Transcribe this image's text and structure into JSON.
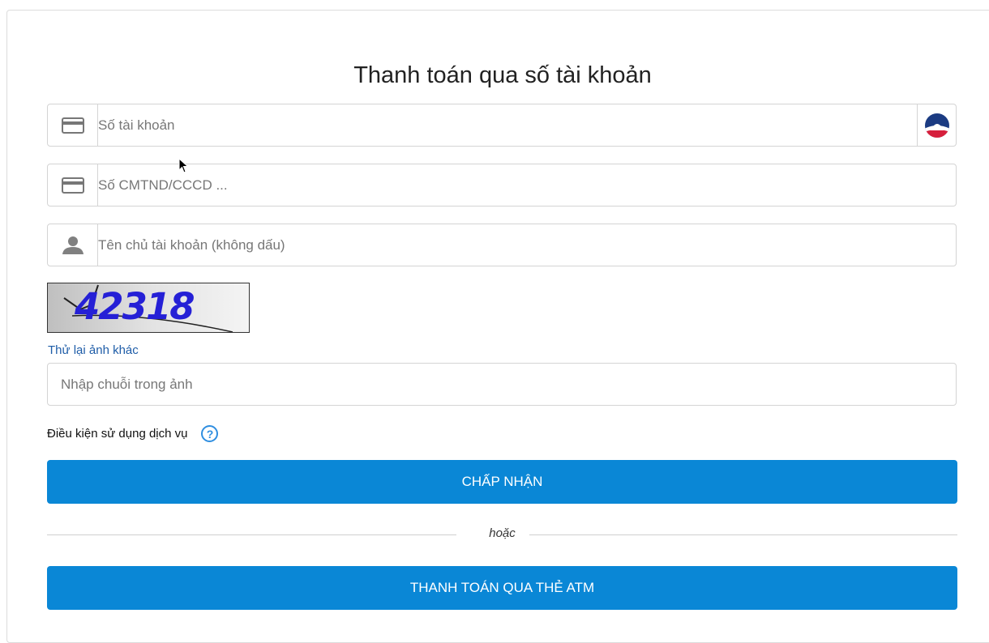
{
  "form": {
    "title": "Thanh toán qua số tài khoản",
    "account_number": {
      "placeholder": "Số tài khoản",
      "value": "",
      "icon": "credit-card-icon",
      "bank_icon": "bank-logo-icon"
    },
    "id_number": {
      "placeholder": "Số CMTND/CCCD ...",
      "value": "",
      "icon": "credit-card-icon"
    },
    "account_holder": {
      "placeholder": "Tên chủ tài khoản (không dấu)",
      "value": "",
      "icon": "user-icon"
    },
    "captcha": {
      "image_text": "42318",
      "retry_label": "Thử lại ảnh khác",
      "input_placeholder": "Nhập chuỗi trong ảnh",
      "input_value": ""
    },
    "terms": {
      "label": "Điều kiện sử dụng dịch vụ",
      "help_icon": "question-circle-icon",
      "help_glyph": "?"
    },
    "accept_button": "CHẤP NHẬN",
    "divider_text": "hoặc",
    "atm_button": "THANH TOÁN QUA THẺ ATM"
  },
  "colors": {
    "primary": "#0a87d6",
    "link": "#1f5da8",
    "help": "#2f8ee0",
    "captcha_text": "#2520d6"
  }
}
